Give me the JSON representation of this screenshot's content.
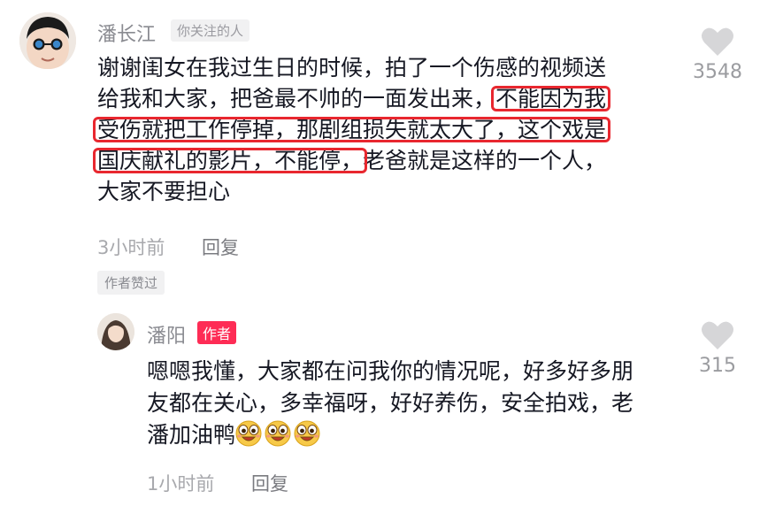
{
  "comment": {
    "user": "潘长江",
    "follow_tag": "你关注的人",
    "lines": [
      {
        "pre": "谢谢闺女在我过生日的时候，拍了一个伤感的视频送",
        "hl": "",
        "post": ""
      },
      {
        "pre": "给我和大家，把爸最不帅的一面发出来，",
        "hl": "不能因为我",
        "post": ""
      },
      {
        "pre": "",
        "hl": "受伤就把工作停掉，那剧组损失就太大了，这个戏是",
        "post": ""
      },
      {
        "pre": "",
        "hl": "国庆献礼的影片，不能停，",
        "post": "老爸就是这样的一个人，"
      },
      {
        "pre": "大家不要担心",
        "hl": "",
        "post": ""
      }
    ],
    "time": "3小时前",
    "reply_label": "回复",
    "liked_tag": "作者赞过",
    "likes": "3548",
    "heart_icon": "heart-outline-icon"
  },
  "reply": {
    "user": "潘阳",
    "author_tag": "作者",
    "lines": [
      "嗯嗯我懂，大家都在问我你的情况呢，好多好多朋",
      "友都在关心，多幸福呀，好好养伤，安全拍戏，老",
      "潘加油鸭"
    ],
    "emojis": [
      "smile-emoji-icon",
      "smile-emoji-icon",
      "smile-emoji-icon"
    ],
    "time": "1小时前",
    "reply_label": "回复",
    "likes": "315",
    "heart_icon": "heart-outline-icon"
  },
  "colors": {
    "highlight_box": "#e8272f",
    "author_tag_bg": "#fe2c55",
    "heart": "#d6d6d8",
    "meta_text": "#a8a9ad"
  }
}
